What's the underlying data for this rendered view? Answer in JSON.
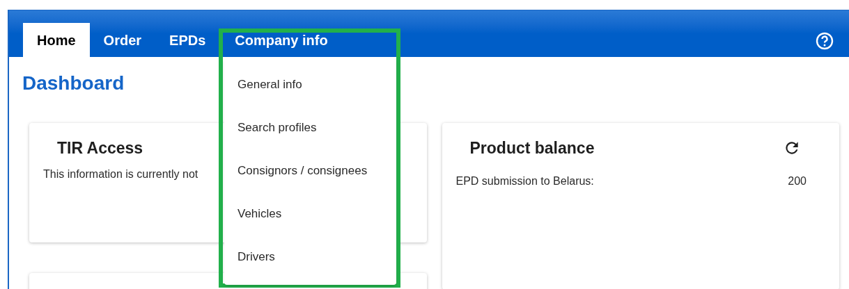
{
  "nav": {
    "tabs": [
      {
        "label": "Home",
        "selected": true
      },
      {
        "label": "Order",
        "selected": false
      },
      {
        "label": "EPDs",
        "selected": false
      },
      {
        "label": "Company info",
        "selected": false,
        "expanded": true
      }
    ]
  },
  "dropdown": {
    "items": [
      "General info",
      "Search profiles",
      "Consignors / consignees",
      "Vehicles",
      "Drivers"
    ]
  },
  "page_title": "Dashboard",
  "cards": [
    {
      "kind": "message",
      "title": "TIR Access",
      "text": "This information is currently not"
    },
    {
      "kind": "balance",
      "title": "Product balance",
      "rows": [
        {
          "label": "EPD submission to Belarus:",
          "value": "200"
        }
      ]
    }
  ]
}
